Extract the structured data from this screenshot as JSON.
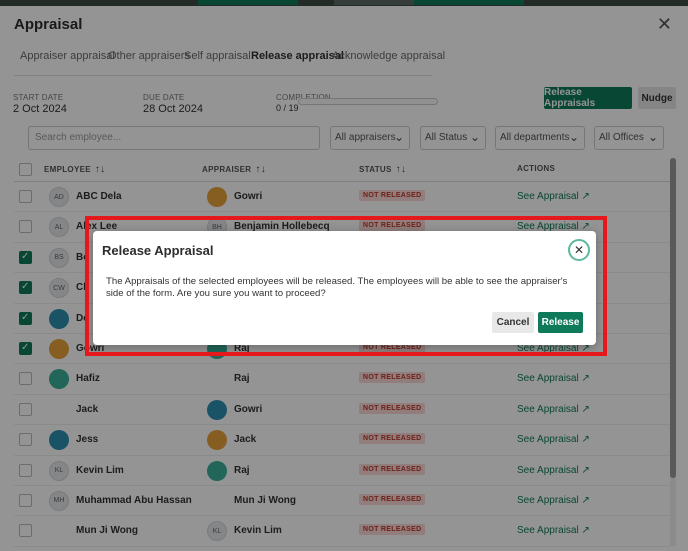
{
  "panel": {
    "title": "Appraisal",
    "close_icon": "close-icon"
  },
  "tabs": [
    "Appraiser appraisal",
    "Other appraisers",
    "Self appraisal",
    "Release appraisal",
    "Acknowledge appraisal"
  ],
  "active_tab": "Release appraisal",
  "meta": {
    "start_label": "START DATE",
    "start_value": "2 Oct 2024",
    "due_label": "DUE DATE",
    "due_value": "28 Oct 2024",
    "completion_label": "COMPLETION",
    "completion_value": "0 / 19",
    "completion_fraction": 0
  },
  "actions": {
    "release_appraisals": "Release Appraisals",
    "nudge": "Nudge"
  },
  "filters": {
    "search_placeholder": "Search employee...",
    "appraisers": "All appraisers",
    "status": "All Status",
    "departments": "All departments",
    "offices": "All Offices"
  },
  "columns": {
    "employee": "EMPLOYEE",
    "appraiser": "APPRAISER",
    "status": "STATUS",
    "actions": "ACTIONS",
    "sort_icon": "sort-icon"
  },
  "rows": [
    {
      "employee": "ABC Dela",
      "emp_avatar": "AD",
      "appraiser": "Gowri",
      "checked": false,
      "status": "NOT RELEASED",
      "action": "See Appraisal"
    },
    {
      "employee": "Alex Lee",
      "emp_avatar": "AL",
      "appraiser": "Benjamin Hollebecq",
      "appr_avatar": "BH",
      "checked": false,
      "status": "NOT RELEASED",
      "action": "See Appraisal"
    },
    {
      "employee": "Be",
      "emp_avatar": "BS",
      "appraiser": "",
      "checked": true,
      "status": "",
      "action": ""
    },
    {
      "employee": "Cl",
      "emp_avatar": "CW",
      "appraiser": "",
      "checked": true,
      "status": "",
      "action": ""
    },
    {
      "employee": "Do",
      "appraiser": "",
      "checked": true,
      "status": "",
      "action": ""
    },
    {
      "employee": "Gowri",
      "appraiser": "Raj",
      "checked": true,
      "status": "NOT RELEASED",
      "action": "See Appraisal"
    },
    {
      "employee": "Hafiz",
      "appraiser": "Raj",
      "checked": false,
      "status": "NOT RELEASED",
      "action": "See Appraisal"
    },
    {
      "employee": "Jack",
      "appraiser": "Gowri",
      "checked": false,
      "status": "NOT RELEASED",
      "action": "See Appraisal"
    },
    {
      "employee": "Jess",
      "appraiser": "Jack",
      "checked": false,
      "status": "NOT RELEASED",
      "action": "See Appraisal"
    },
    {
      "employee": "Kevin Lim",
      "emp_avatar": "KL",
      "appraiser": "Raj",
      "checked": false,
      "status": "NOT RELEASED",
      "action": "See Appraisal"
    },
    {
      "employee": "Muhammad Abu Hassan",
      "emp_avatar": "MH",
      "appraiser": "Mun Ji Wong",
      "checked": false,
      "status": "NOT RELEASED",
      "action": "See Appraisal"
    },
    {
      "employee": "Mun Ji Wong",
      "appraiser": "Kevin Lim",
      "appr_avatar": "KL",
      "checked": false,
      "status": "NOT RELEASED",
      "action": "See Appraisal"
    }
  ],
  "modal": {
    "title": "Release Appraisal",
    "body": "The Appraisals of the selected employees will be released. The employees will be able to see the appraiser's side of the form. Are you sure you want to proceed?",
    "cancel": "Cancel",
    "confirm": "Release"
  },
  "colors": {
    "accent": "#0f7a5a",
    "highlight": "#e5191b",
    "badge_bg": "#f8d7d6",
    "badge_text": "#c0392b"
  }
}
